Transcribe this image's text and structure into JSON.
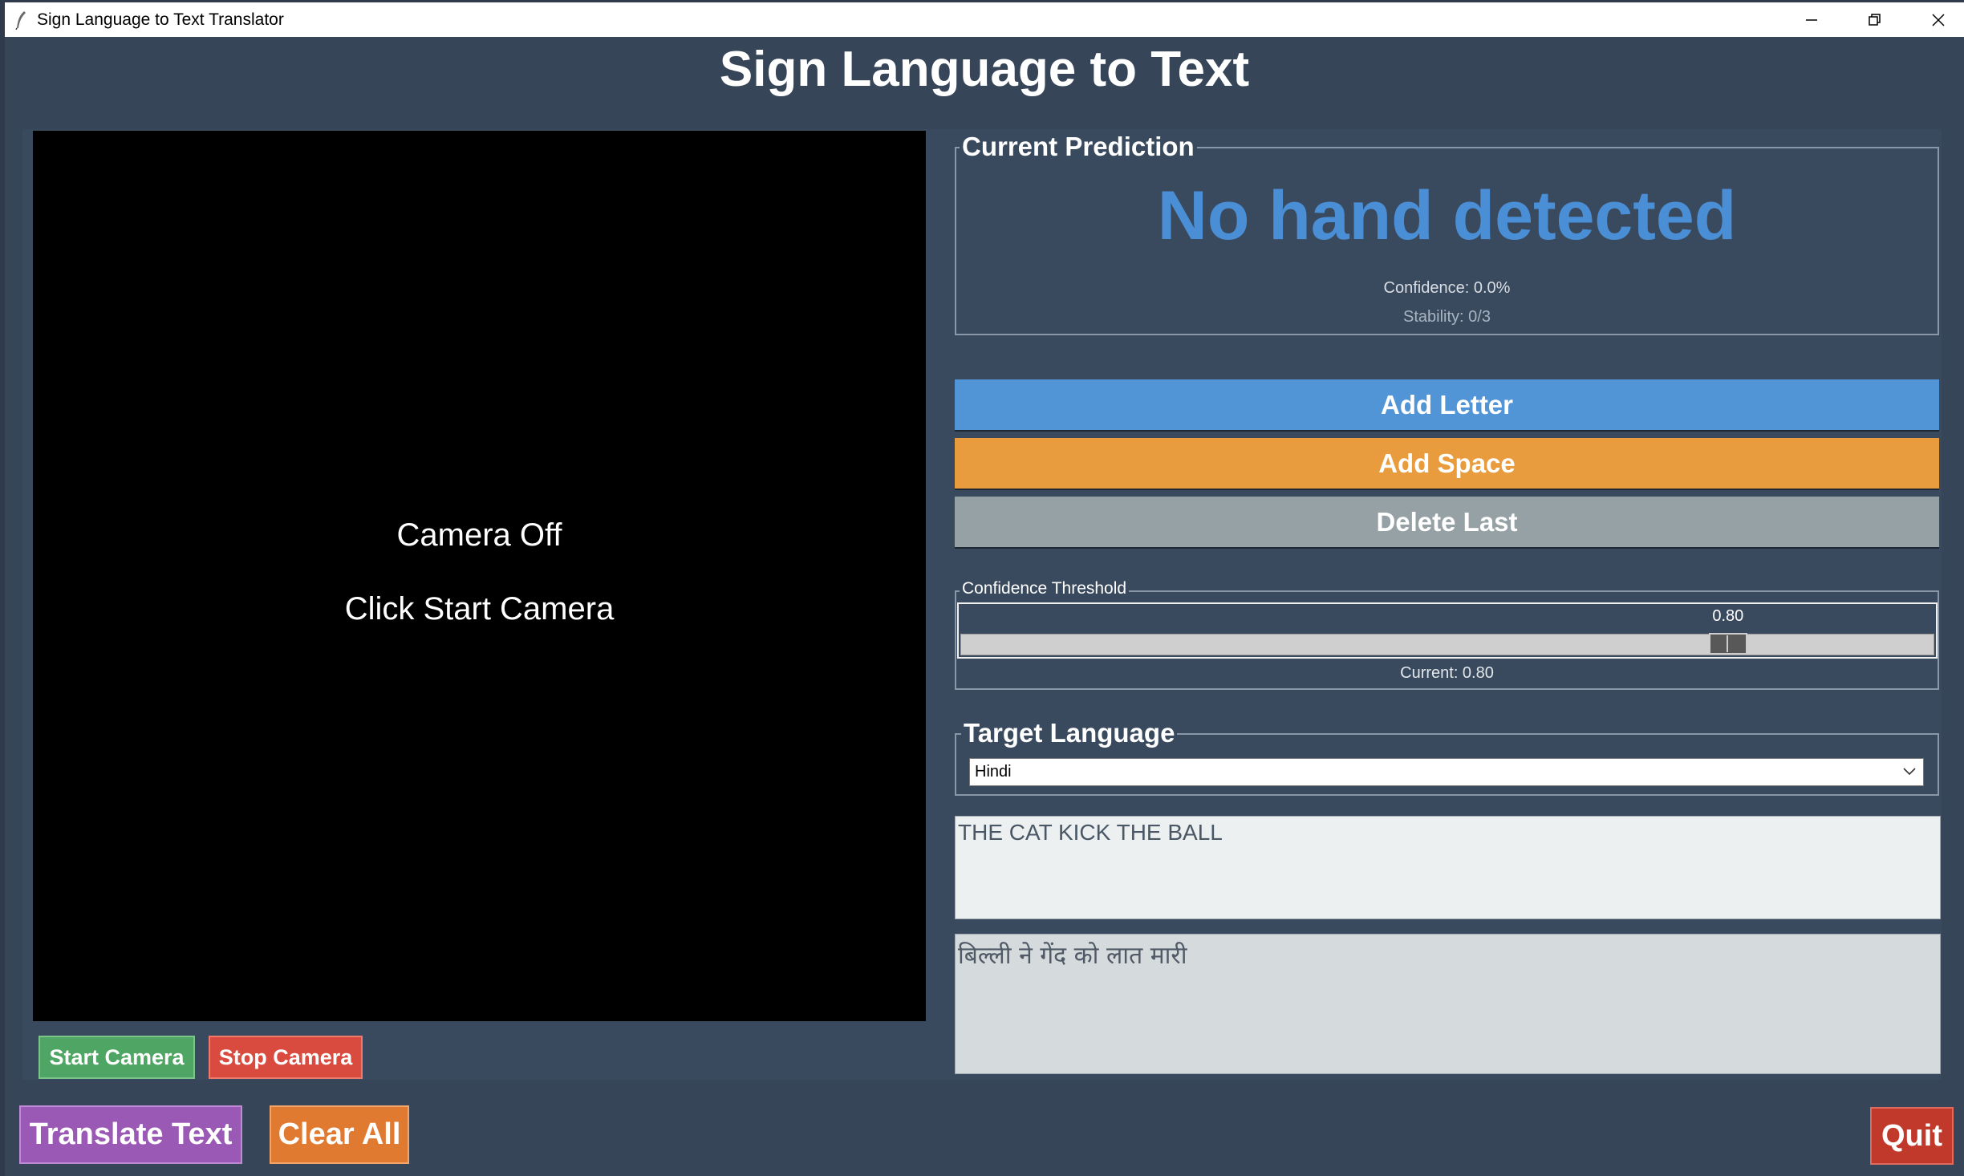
{
  "window": {
    "title": "Sign Language to Text Translator"
  },
  "app": {
    "heading": "Sign Language to Text"
  },
  "camera": {
    "status": "Camera Off",
    "hint": "Click Start Camera",
    "start_label": "Start Camera",
    "stop_label": "Stop Camera"
  },
  "prediction": {
    "legend": "Current Prediction",
    "value": "No hand detected",
    "confidence": "Confidence: 0.0%",
    "stability": "Stability: 0/3"
  },
  "actions": {
    "add_letter": "Add Letter",
    "add_space": "Add Space",
    "delete_last": "Delete Last"
  },
  "threshold": {
    "legend": "Confidence Threshold",
    "value": "0.80",
    "current": "Current: 0.80",
    "level": 0.8
  },
  "language": {
    "legend": "Target Language",
    "selected": "Hindi"
  },
  "text": {
    "source": "THE CAT KICK THE BALL",
    "translated": "बिल्ली ने गेंद को लात मारी"
  },
  "bottom": {
    "translate_label": "Translate Text",
    "clear_label": "Clear All",
    "quit_label": "Quit"
  },
  "colors": {
    "prediction": "#4a8fd6",
    "add_letter": "#5295d6",
    "add_space": "#e89c3d",
    "delete_last": "#95a1a4",
    "start_camera": "#4fa563",
    "stop_camera": "#d94b3e",
    "translate": "#9b59b6",
    "clear_all": "#e07a30",
    "quit": "#c0392b"
  }
}
